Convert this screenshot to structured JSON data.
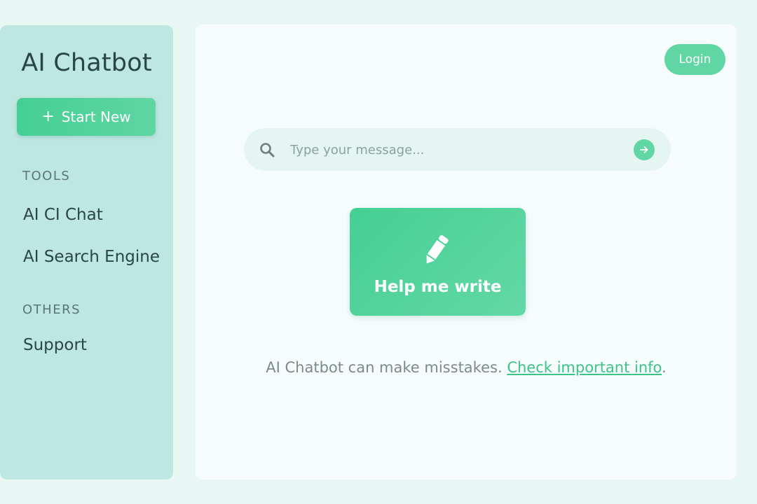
{
  "sidebar": {
    "title": "AI Chatbot",
    "start_new_label": "Start New",
    "sections": [
      {
        "label": "TOOLS",
        "items": [
          {
            "label": "AI CI Chat"
          },
          {
            "label": "AI Search Engine"
          }
        ]
      },
      {
        "label": "OTHERS",
        "items": [
          {
            "label": "Support"
          }
        ]
      }
    ]
  },
  "header": {
    "login_label": "Login"
  },
  "search": {
    "placeholder": "Type your message..."
  },
  "help_card": {
    "label": "Help me write",
    "icon": "pencil-icon"
  },
  "disclaimer": {
    "text": "AI Chatbot can make misstakes.",
    "link_text": "Check important info",
    "trailing": "."
  },
  "icons": {
    "start_new": "plus-icon",
    "search": "search-icon",
    "send": "arrow-right-icon"
  },
  "colors": {
    "background": "#e8f6f4",
    "sidebar": "#bfe7e1",
    "main_panel": "#f6fcfc",
    "accent": "#45cf94",
    "accent_light": "#5fd6a3",
    "link": "#3cc488",
    "title_text": "#2a4644",
    "muted_text": "#7b8b89"
  }
}
